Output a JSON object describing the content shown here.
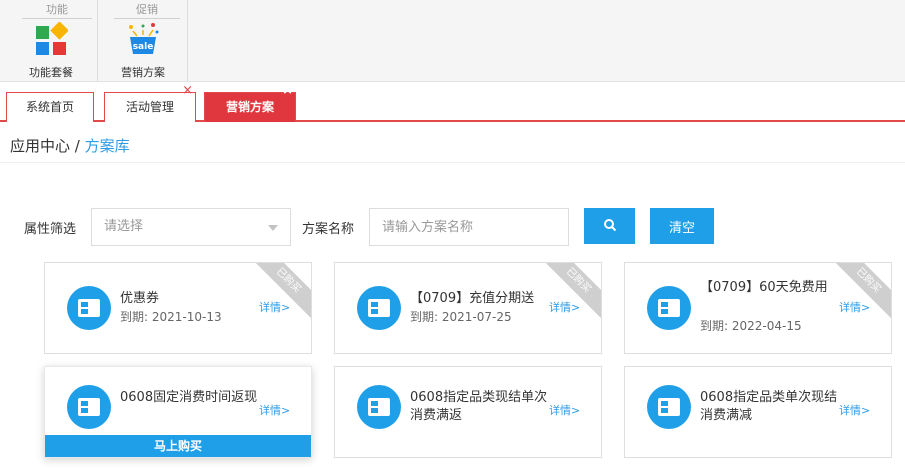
{
  "ribbon": {
    "groups": [
      {
        "title": "功能",
        "button_label": "功能套餐",
        "icon": "app-blocks-icon"
      },
      {
        "title": "促销",
        "button_label": "营销方案",
        "icon": "sale-basket-icon"
      }
    ]
  },
  "tabs": [
    {
      "label": "系统首页",
      "closable": false,
      "active": false
    },
    {
      "label": "活动管理",
      "closable": true,
      "active": false
    },
    {
      "label": "营销方案",
      "closable": true,
      "active": true
    }
  ],
  "breadcrumb": {
    "root": "应用中心",
    "separator": " / ",
    "current": "方案库"
  },
  "filters": {
    "attr_label": "属性筛选",
    "attr_placeholder": "请选择",
    "name_label": "方案名称",
    "name_placeholder": "请输入方案名称",
    "clear_label": "清空"
  },
  "cards": [
    {
      "name": "优惠券",
      "expire": "到期:   2021-10-13",
      "detail": "详情>",
      "tag": "已购买"
    },
    {
      "name": "【0709】充值分期送",
      "expire": "到期:   2021-07-25",
      "detail": "详情>",
      "tag": "已购买"
    },
    {
      "name": "【0709】60天免费用",
      "expire": "到期:   2022-04-15",
      "detail": "详情>",
      "tag": "已购买"
    },
    {
      "name": "0608固定消费时间返现",
      "detail": "详情>",
      "buy": "马上购买"
    },
    {
      "name": "0608指定品类现结单次消费满返",
      "detail": "详情>"
    },
    {
      "name": "0608指定品类单次现结消费满减",
      "detail": "详情>"
    }
  ],
  "colors": {
    "accent_red": "#e0373e",
    "accent_blue": "#1e9fe8"
  }
}
